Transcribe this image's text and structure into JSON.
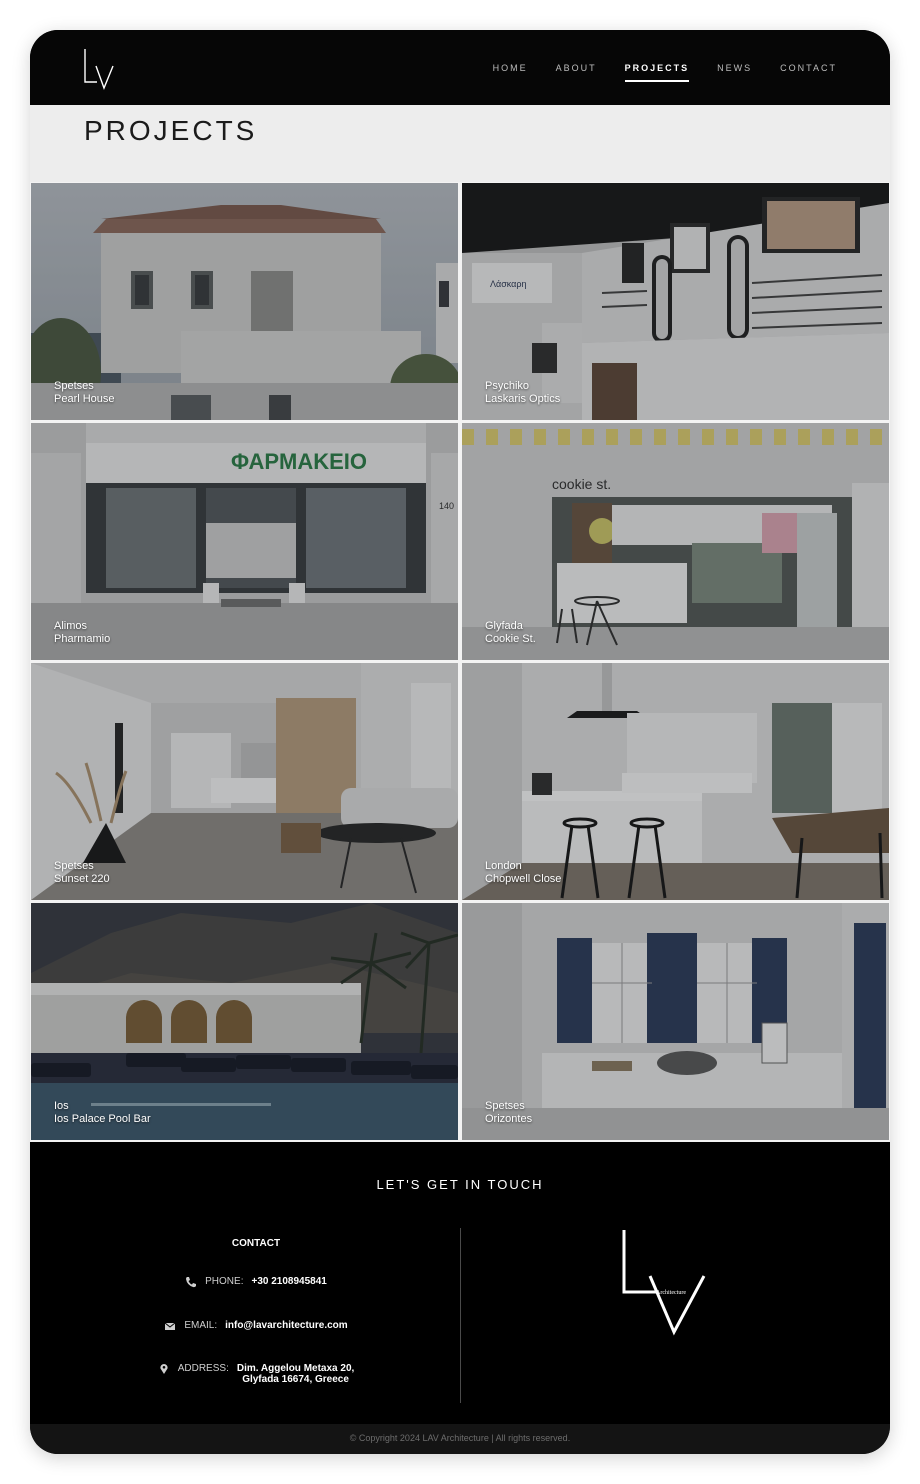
{
  "header": {
    "logo_text": "LV",
    "nav": [
      {
        "label": "HOME",
        "active": false
      },
      {
        "label": "ABOUT",
        "active": false
      },
      {
        "label": "PROJECTS",
        "active": true
      },
      {
        "label": "NEWS",
        "active": false
      },
      {
        "label": "CONTACT",
        "active": false
      }
    ]
  },
  "page_title": "PROJECTS",
  "projects": [
    {
      "location": "Spetses",
      "name": "Pearl House"
    },
    {
      "location": "Psychiko",
      "name": "Laskaris Optics"
    },
    {
      "location": "Alimos",
      "name": "Pharmamio"
    },
    {
      "location": "Glyfada",
      "name": "Cookie St."
    },
    {
      "location": "Spetses",
      "name": "Sunset 220"
    },
    {
      "location": "London",
      "name": "Chopwell Close"
    },
    {
      "location": "Ios",
      "name": "Ios Palace Pool Bar"
    },
    {
      "location": "Spetses",
      "name": "Orizontes"
    }
  ],
  "photo_text": {
    "pharmacy_sign": "ΦΑΡΜΑΚΕΙΟ",
    "pharmacy_number": "140",
    "cookie_sign": "cookie st.",
    "optics_sign": "Λάσκαρη"
  },
  "footer": {
    "heading": "LET'S GET IN TOUCH",
    "contact_title": "CONTACT",
    "phone_label": "PHONE:",
    "phone_value": "+30 2108945841",
    "email_label": "EMAIL:",
    "email_value": "info@lavarchitecture.com",
    "address_label": "ADDRESS:",
    "address_line1": "Dim. Aggelou Metaxa 20,",
    "address_line2": "Glyfada 16674, Greece",
    "logo_text": "LV",
    "logo_subtext": "Architecture",
    "copyright": "© Copyright 2024  LAV Architecture | All rights reserved."
  },
  "colors": {
    "header_bg": "#060606",
    "title_band_bg": "#ededed",
    "footer_bg": "#000000",
    "pharmacy_green": "#2f7d49"
  }
}
